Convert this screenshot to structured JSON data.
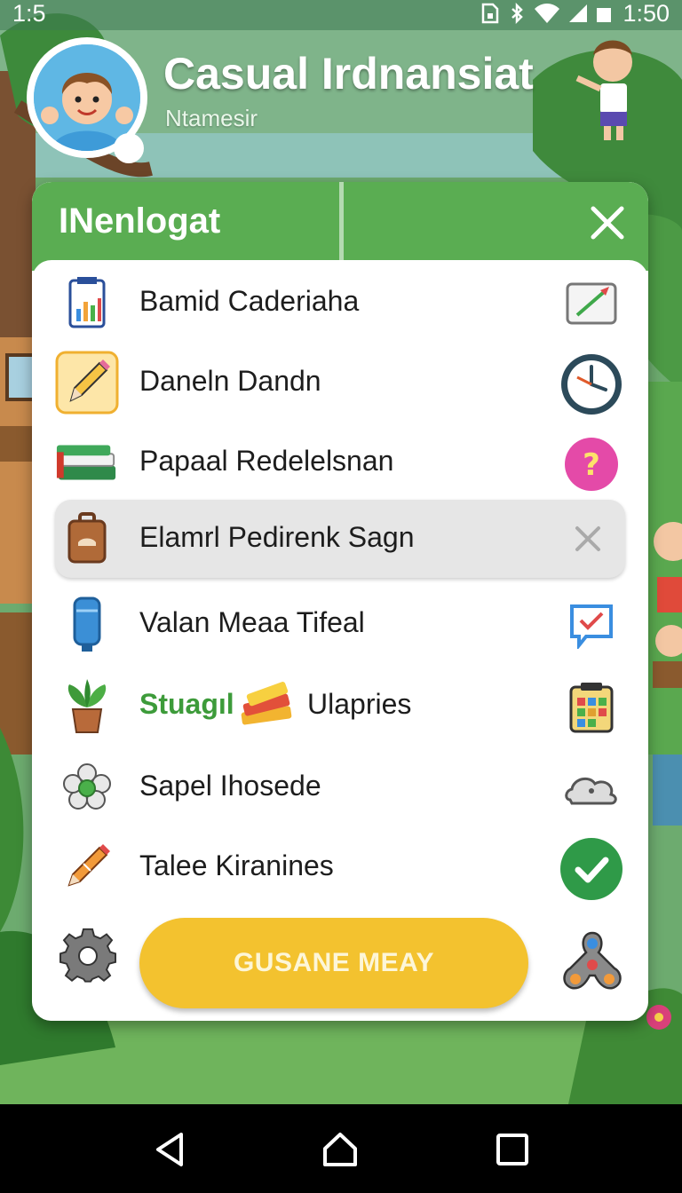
{
  "status_bar": {
    "time_left": "1:5",
    "time_right": "1:50",
    "icons": [
      "sim-icon",
      "bluetooth-icon",
      "wifi-icon",
      "signal-icon",
      "battery-icon"
    ]
  },
  "header": {
    "app_title": "Casual Irdnansiat",
    "subtitle": "Ntamesir",
    "avatar": "boy-waving-avatar"
  },
  "dialog": {
    "title": "INenlogat",
    "close_icon": "close-icon",
    "items": [
      {
        "label": "Bamid Caderiaha",
        "left_icon": "report-clipboard-icon",
        "right_icon": "whiteboard-icon"
      },
      {
        "label": "Daneln Dandn",
        "left_icon": "pencil-icon",
        "right_icon": "clock-icon"
      },
      {
        "label": "Papaal Redelelsnan",
        "left_icon": "books-icon",
        "right_icon": "help-icon"
      },
      {
        "label": "Elamrl Pedirenk Sagn",
        "left_icon": "briefcase-icon",
        "right_icon": "close-icon",
        "selected": true
      },
      {
        "label": "Valan Meaa Tifeal",
        "left_icon": "water-bottle-icon",
        "right_icon": "chat-check-icon"
      },
      {
        "label": "Stuagıl",
        "second_label": "Ulapries",
        "left_icon": "potted-plant-icon",
        "inline_icon": "books-stack-icon",
        "right_icon": "calendar-icon"
      },
      {
        "label": "Sapel Ihosede",
        "left_icon": "flower-icon",
        "right_icon": "cloud-icon"
      },
      {
        "label": "Talee Kiranines",
        "left_icon": "crayon-icon",
        "right_icon": "check-circle-icon"
      }
    ],
    "action_button": "GUSANE MEAY",
    "left_bottom_icon": "gear-icon",
    "right_bottom_icon": "fidget-spinner-icon"
  },
  "nav_bar": {
    "buttons": [
      "back-icon",
      "home-icon",
      "recents-icon"
    ]
  },
  "colors": {
    "header_green": "#5aad52",
    "action_yellow": "#f3c22f",
    "check_green": "#2f9a48",
    "help_pink": "#e44aa8"
  }
}
